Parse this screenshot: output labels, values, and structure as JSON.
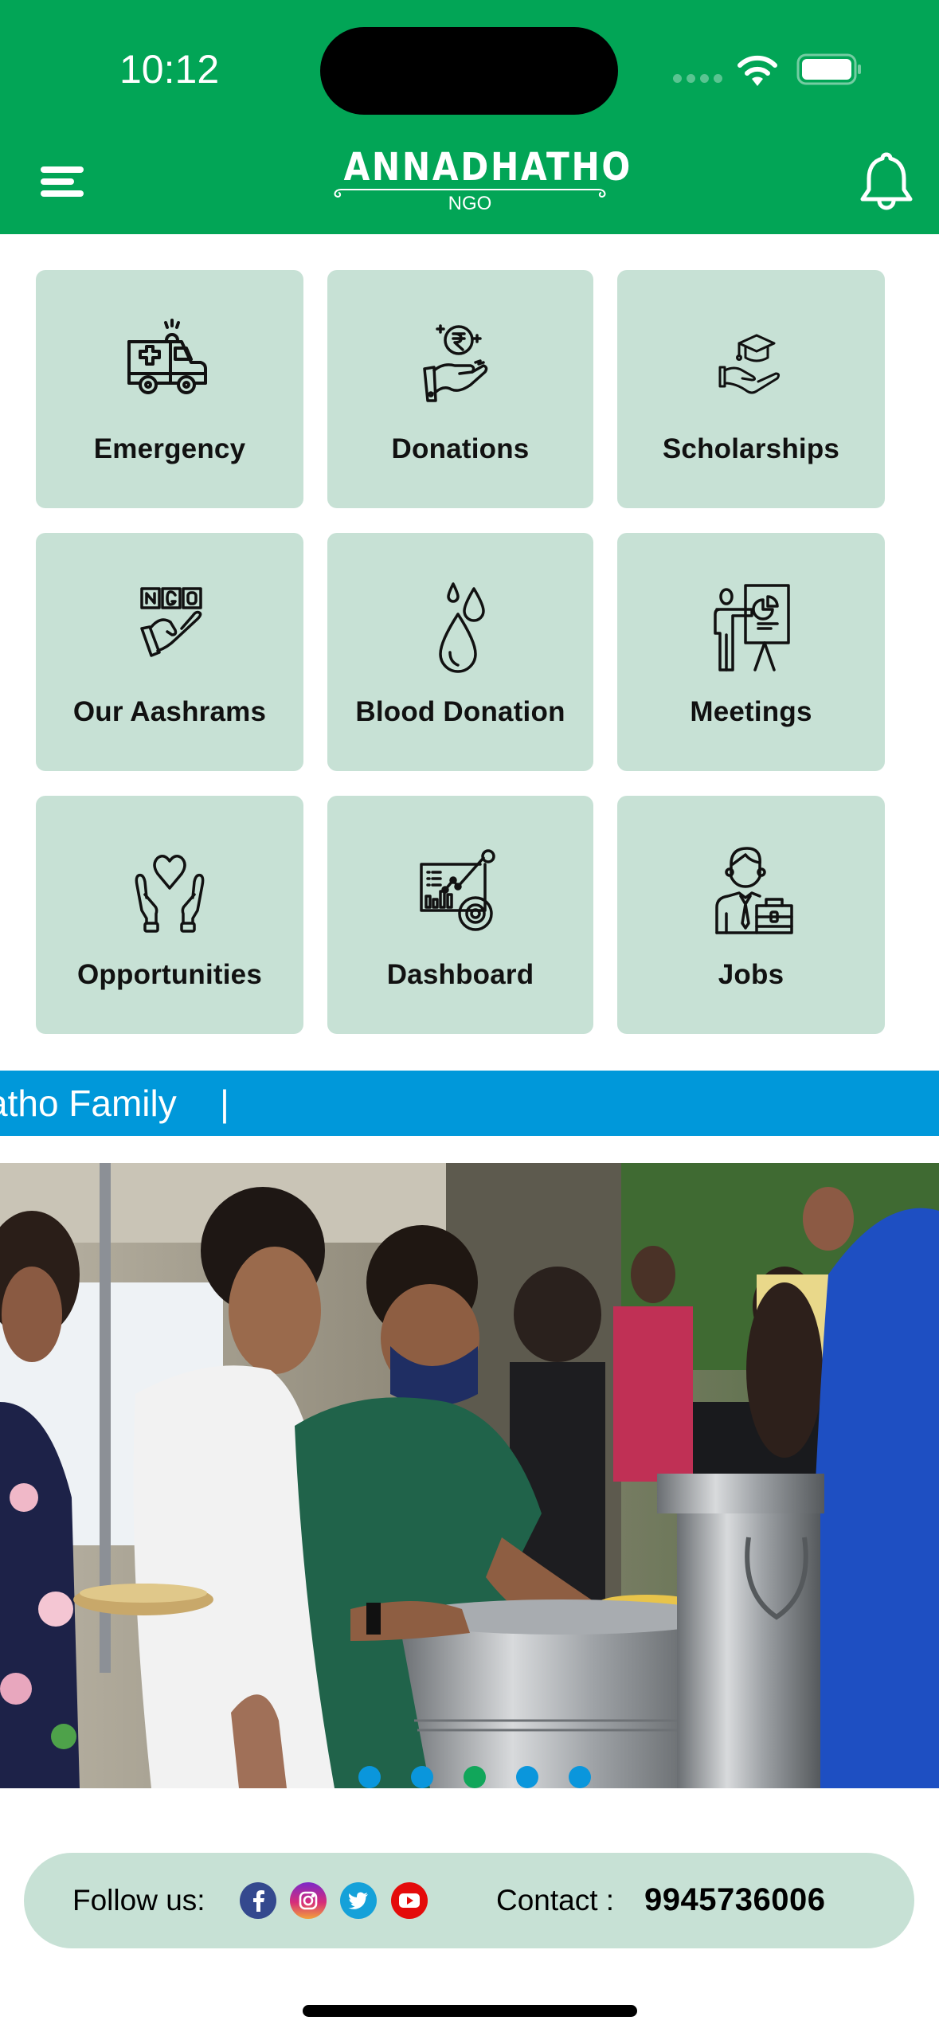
{
  "status_bar": {
    "time": "10:12",
    "signal_icon": "cellular-signal-icon",
    "wifi_icon": "wifi-icon",
    "battery_icon": "battery-icon"
  },
  "header": {
    "menu_icon": "hamburger-menu-icon",
    "logo_title": "ANNADHATHO",
    "logo_subtitle": "NGO",
    "notification_icon": "bell-icon",
    "background_color": "#02A556"
  },
  "menu_grid": {
    "card_color": "#C7E1D5",
    "items": [
      {
        "label": "Emergency",
        "icon": "ambulance-icon"
      },
      {
        "label": "Donations",
        "icon": "rupee-hand-icon"
      },
      {
        "label": "Scholarships",
        "icon": "graduation-hand-icon"
      },
      {
        "label": "Our Aashrams",
        "icon": "ngo-hand-icon"
      },
      {
        "label": "Blood Donation",
        "icon": "blood-drops-icon"
      },
      {
        "label": "Meetings",
        "icon": "presentation-icon"
      },
      {
        "label": "Opportunities",
        "icon": "heart-hands-icon"
      },
      {
        "label": "Dashboard",
        "icon": "analytics-dashboard-icon"
      },
      {
        "label": "Jobs",
        "icon": "businessman-briefcase-icon"
      }
    ]
  },
  "marquee": {
    "text": "atho Family",
    "separator": "|",
    "background_color": "#0098DA"
  },
  "carousel": {
    "image_alt": "Volunteers serving food to people at a food distribution event",
    "slide_count": 5,
    "active_index": 2,
    "dot_color": "#0A96DC",
    "active_dot_color": "#11A65A"
  },
  "footer": {
    "follow_label": "Follow us:",
    "socials": [
      {
        "name": "Facebook",
        "icon": "facebook-icon"
      },
      {
        "name": "Instagram",
        "icon": "instagram-icon"
      },
      {
        "name": "Twitter",
        "icon": "twitter-icon"
      },
      {
        "name": "YouTube",
        "icon": "youtube-icon"
      }
    ],
    "contact_label": "Contact :",
    "contact_phone": "9945736006"
  }
}
